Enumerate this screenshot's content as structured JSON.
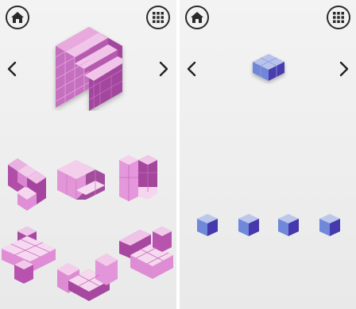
{
  "left_panel": {
    "home_icon": "home-icon",
    "menu_icon": "grid-menu-icon",
    "prev_icon": "chevron-left-icon",
    "next_icon": "chevron-right-icon",
    "target_color": "#b54fb0",
    "piece_color": "#d97ec7",
    "pieces": 6
  },
  "right_panel": {
    "home_icon": "home-icon",
    "menu_icon": "grid-menu-icon",
    "prev_icon": "chevron-left-icon",
    "next_icon": "chevron-right-icon",
    "target_color": "#4b5fc9",
    "pieces": 4
  }
}
